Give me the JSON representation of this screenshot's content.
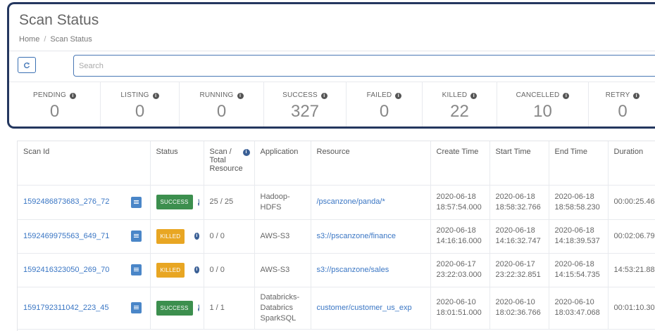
{
  "header": {
    "title": "Scan Status",
    "breadcrumb": [
      "Home",
      "Scan Status"
    ]
  },
  "toolbar": {
    "search_placeholder": "Search"
  },
  "counters": [
    {
      "label": "PENDING",
      "value": "0"
    },
    {
      "label": "LISTING",
      "value": "0"
    },
    {
      "label": "RUNNING",
      "value": "0"
    },
    {
      "label": "SUCCESS",
      "value": "327"
    },
    {
      "label": "FAILED",
      "value": "0"
    },
    {
      "label": "KILLED",
      "value": "22"
    },
    {
      "label": "CANCELLED",
      "value": "10"
    },
    {
      "label": "RETRY",
      "value": "0"
    }
  ],
  "table": {
    "columns": [
      "Scan Id",
      "Status",
      "Scan / Total Resource",
      "Application",
      "Resource",
      "Create Time",
      "Start Time",
      "End Time",
      "Duration"
    ],
    "rows": [
      {
        "scan_id": "1592486873683_276_72",
        "status": "SUCCESS",
        "scan_total": "25 / 25",
        "application": "Hadoop-HDFS",
        "resource": "/pscanzone/panda/*",
        "create_time": "2020-06-18 18:57:54.000",
        "start_time": "2020-06-18 18:58:32.766",
        "end_time": "2020-06-18 18:58:58.230",
        "duration": "00:00:25.46"
      },
      {
        "scan_id": "1592469975563_649_71",
        "status": "KILLED",
        "scan_total": "0 / 0",
        "application": "AWS-S3",
        "resource": "s3://pscanzone/finance",
        "create_time": "2020-06-18 14:16:16.000",
        "start_time": "2020-06-18 14:16:32.747",
        "end_time": "2020-06-18 14:18:39.537",
        "duration": "00:02:06.79"
      },
      {
        "scan_id": "1592416323050_269_70",
        "status": "KILLED",
        "scan_total": "0 / 0",
        "application": "AWS-S3",
        "resource": "s3://pscanzone/sales",
        "create_time": "2020-06-17 23:22:03.000",
        "start_time": "2020-06-17 23:22:32.851",
        "end_time": "2020-06-18 14:15:54.735",
        "duration": "14:53:21.88"
      },
      {
        "scan_id": "1591792311042_223_45",
        "status": "SUCCESS",
        "scan_total": "1 / 1",
        "application": "Databricks-Databrics SparkSQL",
        "resource": "customer/customer_us_exp",
        "create_time": "2020-06-10 18:01:51.000",
        "start_time": "2020-06-10 18:02:36.766",
        "end_time": "2020-06-10 18:03:47.068",
        "duration": "00:01:10.30"
      }
    ]
  },
  "colors": {
    "accent": "#3a76c4",
    "panel_border": "#24375f",
    "success": "#3c8f4e",
    "killed": "#e8a623"
  },
  "icons": {
    "refresh": "refresh-icon",
    "info": "info-icon",
    "document": "document-icon"
  }
}
